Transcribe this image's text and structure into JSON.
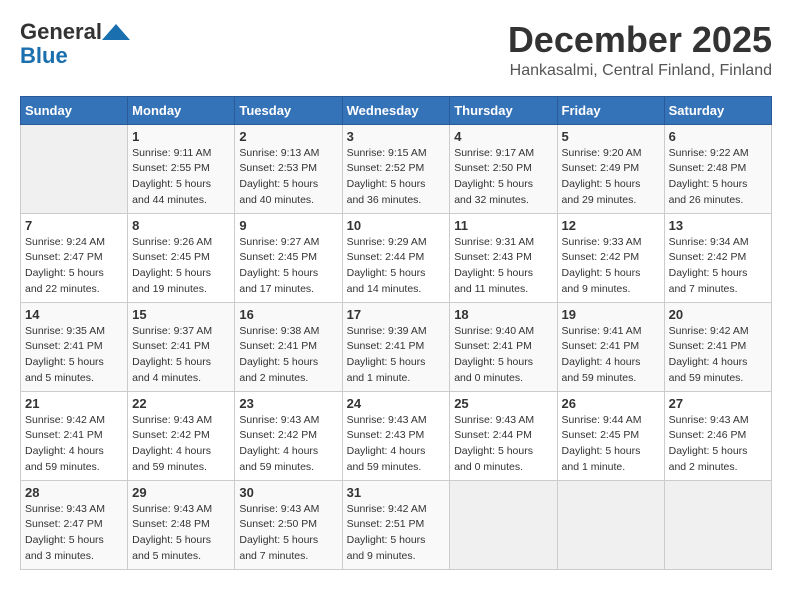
{
  "logo": {
    "line1": "General",
    "line2": "Blue"
  },
  "header": {
    "month": "December 2025",
    "location": "Hankasalmi, Central Finland, Finland"
  },
  "days_of_week": [
    "Sunday",
    "Monday",
    "Tuesday",
    "Wednesday",
    "Thursday",
    "Friday",
    "Saturday"
  ],
  "weeks": [
    [
      {
        "day": "",
        "info": ""
      },
      {
        "day": "1",
        "info": "Sunrise: 9:11 AM\nSunset: 2:55 PM\nDaylight: 5 hours\nand 44 minutes."
      },
      {
        "day": "2",
        "info": "Sunrise: 9:13 AM\nSunset: 2:53 PM\nDaylight: 5 hours\nand 40 minutes."
      },
      {
        "day": "3",
        "info": "Sunrise: 9:15 AM\nSunset: 2:52 PM\nDaylight: 5 hours\nand 36 minutes."
      },
      {
        "day": "4",
        "info": "Sunrise: 9:17 AM\nSunset: 2:50 PM\nDaylight: 5 hours\nand 32 minutes."
      },
      {
        "day": "5",
        "info": "Sunrise: 9:20 AM\nSunset: 2:49 PM\nDaylight: 5 hours\nand 29 minutes."
      },
      {
        "day": "6",
        "info": "Sunrise: 9:22 AM\nSunset: 2:48 PM\nDaylight: 5 hours\nand 26 minutes."
      }
    ],
    [
      {
        "day": "7",
        "info": "Sunrise: 9:24 AM\nSunset: 2:47 PM\nDaylight: 5 hours\nand 22 minutes."
      },
      {
        "day": "8",
        "info": "Sunrise: 9:26 AM\nSunset: 2:45 PM\nDaylight: 5 hours\nand 19 minutes."
      },
      {
        "day": "9",
        "info": "Sunrise: 9:27 AM\nSunset: 2:45 PM\nDaylight: 5 hours\nand 17 minutes."
      },
      {
        "day": "10",
        "info": "Sunrise: 9:29 AM\nSunset: 2:44 PM\nDaylight: 5 hours\nand 14 minutes."
      },
      {
        "day": "11",
        "info": "Sunrise: 9:31 AM\nSunset: 2:43 PM\nDaylight: 5 hours\nand 11 minutes."
      },
      {
        "day": "12",
        "info": "Sunrise: 9:33 AM\nSunset: 2:42 PM\nDaylight: 5 hours\nand 9 minutes."
      },
      {
        "day": "13",
        "info": "Sunrise: 9:34 AM\nSunset: 2:42 PM\nDaylight: 5 hours\nand 7 minutes."
      }
    ],
    [
      {
        "day": "14",
        "info": "Sunrise: 9:35 AM\nSunset: 2:41 PM\nDaylight: 5 hours\nand 5 minutes."
      },
      {
        "day": "15",
        "info": "Sunrise: 9:37 AM\nSunset: 2:41 PM\nDaylight: 5 hours\nand 4 minutes."
      },
      {
        "day": "16",
        "info": "Sunrise: 9:38 AM\nSunset: 2:41 PM\nDaylight: 5 hours\nand 2 minutes."
      },
      {
        "day": "17",
        "info": "Sunrise: 9:39 AM\nSunset: 2:41 PM\nDaylight: 5 hours\nand 1 minute."
      },
      {
        "day": "18",
        "info": "Sunrise: 9:40 AM\nSunset: 2:41 PM\nDaylight: 5 hours\nand 0 minutes."
      },
      {
        "day": "19",
        "info": "Sunrise: 9:41 AM\nSunset: 2:41 PM\nDaylight: 4 hours\nand 59 minutes."
      },
      {
        "day": "20",
        "info": "Sunrise: 9:42 AM\nSunset: 2:41 PM\nDaylight: 4 hours\nand 59 minutes."
      }
    ],
    [
      {
        "day": "21",
        "info": "Sunrise: 9:42 AM\nSunset: 2:41 PM\nDaylight: 4 hours\nand 59 minutes."
      },
      {
        "day": "22",
        "info": "Sunrise: 9:43 AM\nSunset: 2:42 PM\nDaylight: 4 hours\nand 59 minutes."
      },
      {
        "day": "23",
        "info": "Sunrise: 9:43 AM\nSunset: 2:42 PM\nDaylight: 4 hours\nand 59 minutes."
      },
      {
        "day": "24",
        "info": "Sunrise: 9:43 AM\nSunset: 2:43 PM\nDaylight: 4 hours\nand 59 minutes."
      },
      {
        "day": "25",
        "info": "Sunrise: 9:43 AM\nSunset: 2:44 PM\nDaylight: 5 hours\nand 0 minutes."
      },
      {
        "day": "26",
        "info": "Sunrise: 9:44 AM\nSunset: 2:45 PM\nDaylight: 5 hours\nand 1 minute."
      },
      {
        "day": "27",
        "info": "Sunrise: 9:43 AM\nSunset: 2:46 PM\nDaylight: 5 hours\nand 2 minutes."
      }
    ],
    [
      {
        "day": "28",
        "info": "Sunrise: 9:43 AM\nSunset: 2:47 PM\nDaylight: 5 hours\nand 3 minutes."
      },
      {
        "day": "29",
        "info": "Sunrise: 9:43 AM\nSunset: 2:48 PM\nDaylight: 5 hours\nand 5 minutes."
      },
      {
        "day": "30",
        "info": "Sunrise: 9:43 AM\nSunset: 2:50 PM\nDaylight: 5 hours\nand 7 minutes."
      },
      {
        "day": "31",
        "info": "Sunrise: 9:42 AM\nSunset: 2:51 PM\nDaylight: 5 hours\nand 9 minutes."
      },
      {
        "day": "",
        "info": ""
      },
      {
        "day": "",
        "info": ""
      },
      {
        "day": "",
        "info": ""
      }
    ]
  ]
}
